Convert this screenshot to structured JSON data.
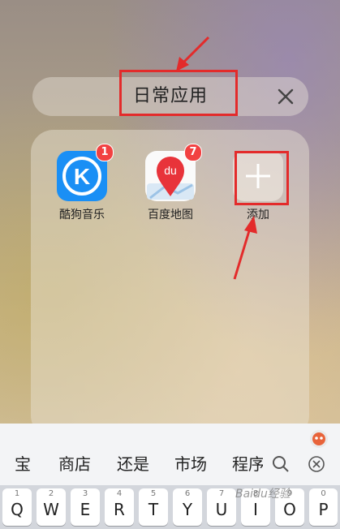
{
  "folder": {
    "title": "日常应用",
    "apps": [
      {
        "name": "酷狗音乐",
        "badge": "1",
        "icon": "kugou-music-icon"
      },
      {
        "name": "百度地图",
        "badge": "7",
        "icon": "baidu-map-icon",
        "icon_text": "du"
      },
      {
        "name": "添加",
        "icon": "plus-icon"
      }
    ]
  },
  "keyboard": {
    "candidates": [
      "宝",
      "商店",
      "还是",
      "市场",
      "程序"
    ],
    "keys": [
      {
        "num": "1",
        "letter": "Q"
      },
      {
        "num": "2",
        "letter": "W"
      },
      {
        "num": "3",
        "letter": "E"
      },
      {
        "num": "4",
        "letter": "R"
      },
      {
        "num": "5",
        "letter": "T"
      },
      {
        "num": "6",
        "letter": "Y"
      },
      {
        "num": "7",
        "letter": "U"
      },
      {
        "num": "8",
        "letter": "I"
      },
      {
        "num": "9",
        "letter": "O"
      },
      {
        "num": "0",
        "letter": "P"
      }
    ]
  },
  "watermark": "Baidu经验",
  "colors": {
    "annotation": "#e32b2b",
    "badge": "#f24141",
    "kugou": "#1a8ff5"
  }
}
